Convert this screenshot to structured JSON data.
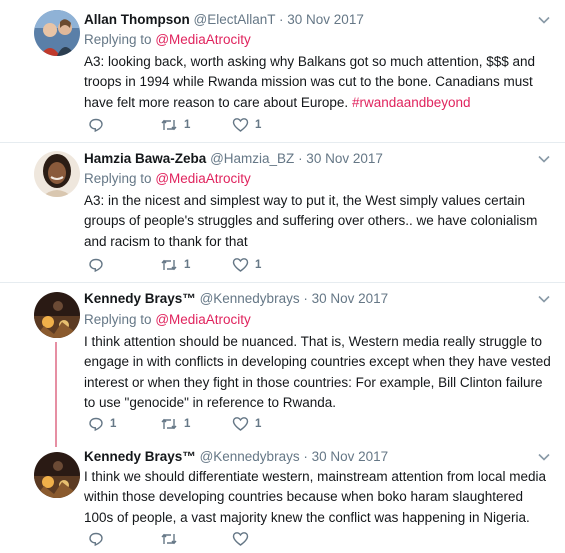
{
  "tweets": [
    {
      "name": "Allan Thompson",
      "handle": "@ElectAllanT",
      "date": "· 30 Nov 2017",
      "replying_prefix": "Replying to",
      "replying_to": "@MediaAtrocity",
      "text": "A3: looking back, worth asking why Balkans got so much attention, $$$ and troops in 1994 while Rwanda mission was cut to the bone. Canadians must have felt more reason to care about Europe.",
      "hashtag": "#rwandaandbeyond",
      "retweets": "1",
      "likes": "1"
    },
    {
      "name": "Hamzia Bawa-Zeba",
      "handle": "@Hamzia_BZ",
      "date": "· 30 Nov 2017",
      "replying_prefix": "Replying to",
      "replying_to": "@MediaAtrocity",
      "text": "A3: in the nicest and simplest way to put it, the West simply values certain groups of people's struggles and suffering over others.. we have colonialism and racism to thank for that",
      "retweets": "1",
      "likes": "1"
    },
    {
      "name": "Kennedy Brays™",
      "handle": "@Kennedybrays",
      "date": "· 30 Nov 2017",
      "replying_prefix": "Replying to",
      "replying_to": "@MediaAtrocity",
      "text": "I think attention should be nuanced. That is, Western media really struggle to engage in with conflicts in developing countries except when they have vested interest or when they fight in those countries: For example, Bill Clinton failure to use \"genocide\" in reference to Rwanda.",
      "replies": "1",
      "retweets": "1",
      "likes": "1"
    },
    {
      "name": "Kennedy Brays™",
      "handle": "@Kennedybrays",
      "date": "· 30 Nov 2017",
      "text": "I think we should differentiate western, mainstream attention from local media within those developing countries because when boko haram slaughtered 100s of people, a vast majority knew the conflict was happening in Nigeria."
    }
  ],
  "colors": {
    "accent": "#e0245e",
    "thread_line": "#e68fa3",
    "muted": "#657786"
  },
  "icons": [
    "reply-icon",
    "retweet-icon",
    "like-icon",
    "chevron-down-icon"
  ]
}
